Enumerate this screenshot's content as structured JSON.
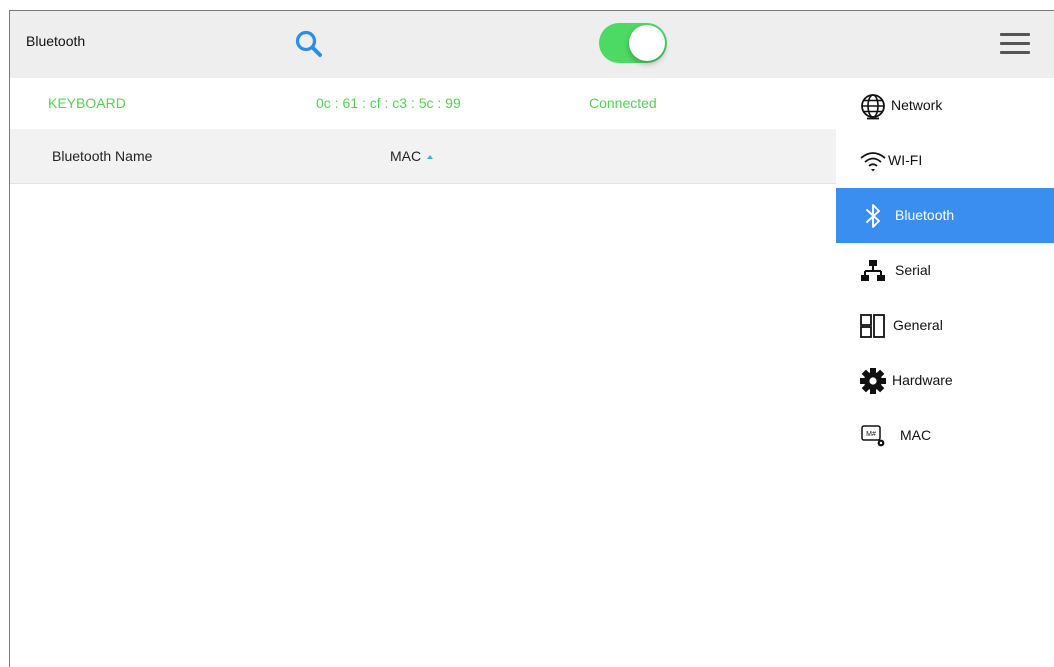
{
  "header": {
    "title": "Bluetooth",
    "bluetooth_enabled": true,
    "accent_color": "#4cd964",
    "search_icon": "search-icon",
    "menu_icon": "hamburger-menu-icon"
  },
  "device": {
    "name": "KEYBOARD",
    "mac": "0c : 61 : cf : c3 : 5c : 99",
    "status": "Connected",
    "status_color": "#55d056"
  },
  "table": {
    "columns": [
      {
        "label": "Bluetooth Name"
      },
      {
        "label": "MAC",
        "sorted": "ascending"
      }
    ],
    "rows": []
  },
  "sidebar": {
    "active_color": "#3a8ef0",
    "items": [
      {
        "label": "Network",
        "icon": "globe-icon"
      },
      {
        "label": "WI-FI",
        "icon": "wifi-icon"
      },
      {
        "label": "Bluetooth",
        "icon": "bluetooth-icon",
        "active": true
      },
      {
        "label": "Serial",
        "icon": "serial-network-icon"
      },
      {
        "label": "General",
        "icon": "layout-grid-icon"
      },
      {
        "label": "Hardware",
        "icon": "gear-icon"
      },
      {
        "label": "MAC",
        "icon": "mac-settings-icon"
      }
    ]
  }
}
